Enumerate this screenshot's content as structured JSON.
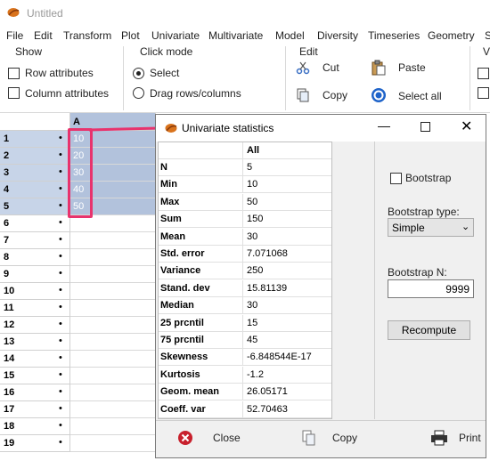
{
  "window": {
    "title": "Untitled"
  },
  "menu": [
    "File",
    "Edit",
    "Transform",
    "Plot",
    "Univariate",
    "Multivariate",
    "Model",
    "Diversity",
    "Timeseries",
    "Geometry",
    "S"
  ],
  "ribbon": {
    "show": {
      "title": "Show",
      "row_attributes": "Row attributes",
      "column_attributes": "Column attributes"
    },
    "click_mode": {
      "title": "Click mode",
      "select": "Select",
      "drag": "Drag rows/columns"
    },
    "edit": {
      "title": "Edit",
      "cut": "Cut",
      "paste": "Paste",
      "copy": "Copy",
      "select_all": "Select all"
    },
    "partial_title": "V"
  },
  "grid": {
    "column_header": "A",
    "rows": [
      {
        "num": "1",
        "dot": "•",
        "value": "10"
      },
      {
        "num": "2",
        "dot": "•",
        "value": "20"
      },
      {
        "num": "3",
        "dot": "•",
        "value": "30"
      },
      {
        "num": "4",
        "dot": "•",
        "value": "40"
      },
      {
        "num": "5",
        "dot": "•",
        "value": "50"
      },
      {
        "num": "6",
        "dot": "•",
        "value": ""
      },
      {
        "num": "7",
        "dot": "•",
        "value": ""
      },
      {
        "num": "8",
        "dot": "•",
        "value": ""
      },
      {
        "num": "9",
        "dot": "•",
        "value": ""
      },
      {
        "num": "10",
        "dot": "•",
        "value": ""
      },
      {
        "num": "11",
        "dot": "•",
        "value": ""
      },
      {
        "num": "12",
        "dot": "•",
        "value": ""
      },
      {
        "num": "13",
        "dot": "•",
        "value": ""
      },
      {
        "num": "14",
        "dot": "•",
        "value": ""
      },
      {
        "num": "15",
        "dot": "•",
        "value": ""
      },
      {
        "num": "16",
        "dot": "•",
        "value": ""
      },
      {
        "num": "17",
        "dot": "•",
        "value": ""
      },
      {
        "num": "18",
        "dot": "•",
        "value": ""
      },
      {
        "num": "19",
        "dot": "•",
        "value": ""
      }
    ]
  },
  "dialog": {
    "title": "Univariate statistics",
    "column_header": "All",
    "stats": [
      {
        "name": "N",
        "value": "5"
      },
      {
        "name": "Min",
        "value": "10"
      },
      {
        "name": "Max",
        "value": "50"
      },
      {
        "name": "Sum",
        "value": "150"
      },
      {
        "name": "Mean",
        "value": "30"
      },
      {
        "name": "Std. error",
        "value": "7.071068"
      },
      {
        "name": "Variance",
        "value": "250"
      },
      {
        "name": "Stand. dev",
        "value": "15.81139"
      },
      {
        "name": "Median",
        "value": "30"
      },
      {
        "name": "25 prcntil",
        "value": "15"
      },
      {
        "name": "75 prcntil",
        "value": "45"
      },
      {
        "name": "Skewness",
        "value": "-6.848544E-17"
      },
      {
        "name": "Kurtosis",
        "value": "-1.2"
      },
      {
        "name": "Geom. mean",
        "value": "26.05171"
      },
      {
        "name": "Coeff. var",
        "value": "52.70463"
      }
    ],
    "bootstrap_label": "Bootstrap",
    "bootstrap_type_label": "Bootstrap type:",
    "bootstrap_type_value": "Simple",
    "bootstrap_n_label": "Bootstrap N:",
    "bootstrap_n_value": "9999",
    "recompute": "Recompute",
    "close": "Close",
    "copy": "Copy",
    "print": "Print"
  },
  "colors": {
    "highlight": "#e8336d",
    "selection": "#b2c2dc",
    "row_selection": "#c7d4e8",
    "dialog_bg": "#f0f0f0"
  },
  "icons": [
    "app-icon",
    "cut-icon",
    "paste-icon",
    "copy-icon",
    "select-all-icon",
    "close-icon",
    "copy-icon",
    "print-icon"
  ]
}
